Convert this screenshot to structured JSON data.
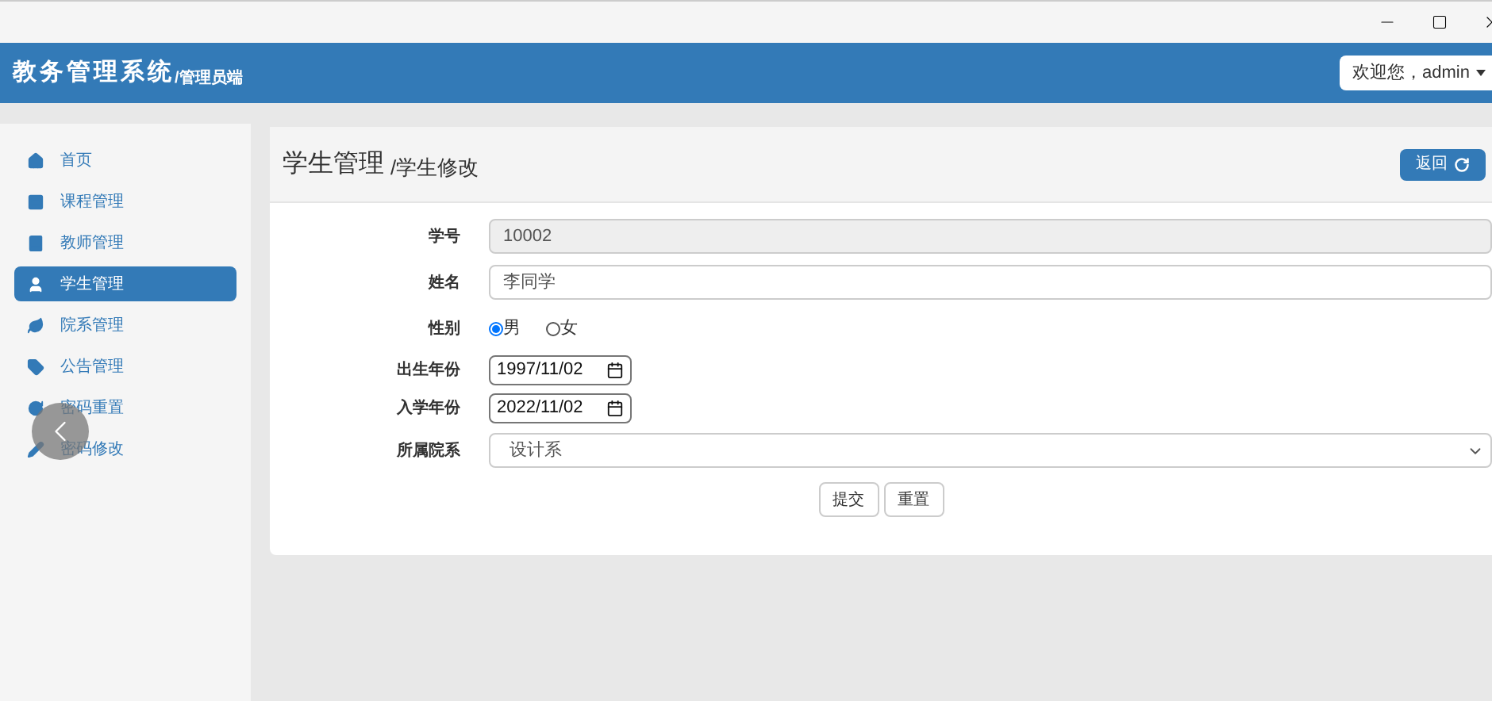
{
  "header": {
    "title": "教务管理系统",
    "subtitle": "/管理员端",
    "user_menu": "欢迎您，admin"
  },
  "sidebar": {
    "items": [
      {
        "label": "首页",
        "selected": false
      },
      {
        "label": "课程管理",
        "selected": false
      },
      {
        "label": "教师管理",
        "selected": false
      },
      {
        "label": "学生管理",
        "selected": true
      },
      {
        "label": "院系管理",
        "selected": false
      },
      {
        "label": "公告管理",
        "selected": false
      },
      {
        "label": "密码重置",
        "selected": false
      },
      {
        "label": "密码修改",
        "selected": false
      }
    ]
  },
  "page": {
    "title": "学生管理",
    "subtitle": "/学生修改",
    "back_button": "返回"
  },
  "form": {
    "fields": [
      {
        "kind": "text",
        "label": "学号",
        "value": "10002",
        "disabled": true
      },
      {
        "kind": "text",
        "label": "姓名",
        "value": "李同学",
        "disabled": false
      },
      {
        "kind": "radio",
        "label": "性别",
        "options": [
          {
            "label": "男",
            "selected": true
          },
          {
            "label": "女",
            "selected": false
          }
        ]
      },
      {
        "kind": "date",
        "label": "出生年份",
        "value": "1997/11/02"
      },
      {
        "kind": "date",
        "label": "入学年份",
        "value": "2022/11/02"
      },
      {
        "kind": "select",
        "label": "所属院系",
        "value": "设计系"
      }
    ],
    "buttons": [
      "提交",
      "重置"
    ]
  }
}
